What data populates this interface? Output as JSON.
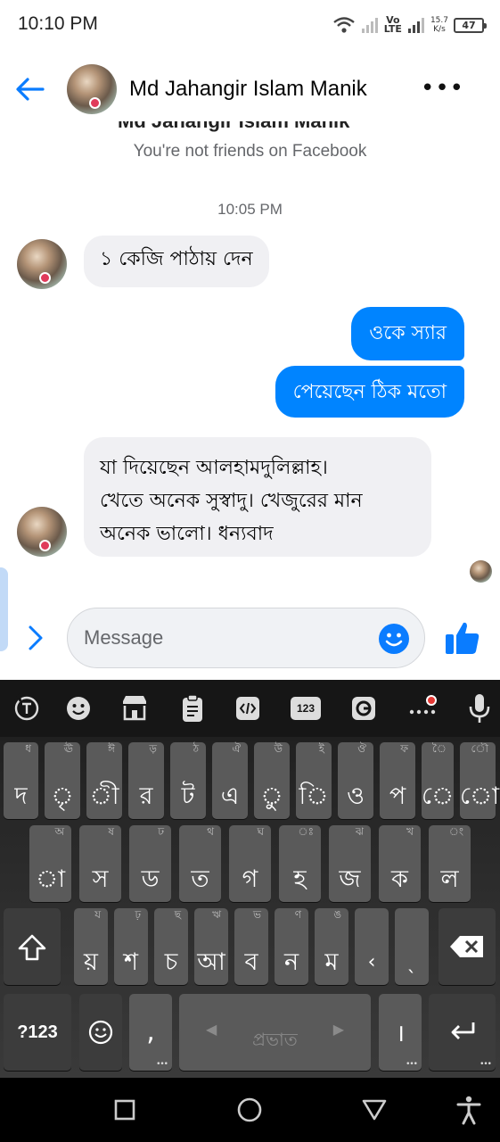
{
  "status_bar": {
    "time": "10:10 PM",
    "network_line1": "Vo",
    "network_line2": "LTE",
    "speed_value": "15.7",
    "speed_unit": "K/s",
    "battery": "47"
  },
  "header": {
    "contact_name": "Md Jahangir Islam Manik",
    "more_icon": "more-icon"
  },
  "conversation": {
    "cut_off_name": "Md Jahangir Islam Manik",
    "not_friends_notice": "You're not friends on Facebook",
    "timestamp": "10:05 PM",
    "messages": [
      {
        "direction": "incoming",
        "text": "১ কেজি পাঠায় দেন"
      },
      {
        "direction": "outgoing",
        "text": "ওকে স্যার"
      },
      {
        "direction": "outgoing",
        "text": "পেয়েছেন ঠিক মতো"
      },
      {
        "direction": "incoming",
        "lines": [
          "যা দিয়েছেন আলহামদুলিল্লাহ।",
          "খেতে অনেক সুস্বাদু। খেজুরের মান",
          "অনেক ভালো। ধন্যবাদ"
        ]
      }
    ]
  },
  "composer": {
    "placeholder": "Message"
  },
  "keyboard": {
    "toolbar_icons": [
      "translate-icon",
      "emoji-icon",
      "store-icon",
      "clipboard-icon",
      "code-icon",
      "numpad-icon",
      "gif-icon",
      "more-dots-icon",
      "microphone-icon"
    ],
    "numpad_label": "123",
    "row1": [
      {
        "main": "দ",
        "hint": "ধ"
      },
      {
        "main": "ৃ",
        "hint": "ঊ"
      },
      {
        "main": "ী",
        "hint": "ঈ"
      },
      {
        "main": "র",
        "hint": "ড়"
      },
      {
        "main": "ট",
        "hint": "ঠ"
      },
      {
        "main": "এ",
        "hint": "ঐ"
      },
      {
        "main": "ু",
        "hint": "উ"
      },
      {
        "main": "ি",
        "hint": "ই"
      },
      {
        "main": "ও",
        "hint": "ঔ"
      },
      {
        "main": "প",
        "hint": "ফ"
      },
      {
        "main": "ে",
        "hint": "ৈ"
      },
      {
        "main": "ো",
        "hint": "ৌ"
      }
    ],
    "row2": [
      {
        "main": "া",
        "hint": "অ"
      },
      {
        "main": "স",
        "hint": "ষ"
      },
      {
        "main": "ড",
        "hint": "ঢ"
      },
      {
        "main": "ত",
        "hint": "থ"
      },
      {
        "main": "গ",
        "hint": "ঘ"
      },
      {
        "main": "হ",
        "hint": "ঃ"
      },
      {
        "main": "জ",
        "hint": "ঝ"
      },
      {
        "main": "ক",
        "hint": "খ"
      },
      {
        "main": "ল",
        "hint": "ং"
      }
    ],
    "row3": [
      {
        "main": "য়",
        "hint": "য"
      },
      {
        "main": "শ",
        "hint": "ঢ়"
      },
      {
        "main": "চ",
        "hint": "ছ"
      },
      {
        "main": "আ",
        "hint": "ঋ"
      },
      {
        "main": "ব",
        "hint": "ভ"
      },
      {
        "main": "ন",
        "hint": "ণ"
      },
      {
        "main": "ম",
        "hint": "ঙ"
      },
      {
        "main": "‹",
        "hint": ""
      },
      {
        "main": "ˎ",
        "hint": ""
      }
    ],
    "symbols_label": "?123",
    "comma_label": ",",
    "space_label": "প্রভাত",
    "period_label": "।"
  },
  "colors": {
    "accent": "#0084ff",
    "incoming_bubble": "#f0f0f3",
    "keyboard_key": "#5a5a5a"
  }
}
